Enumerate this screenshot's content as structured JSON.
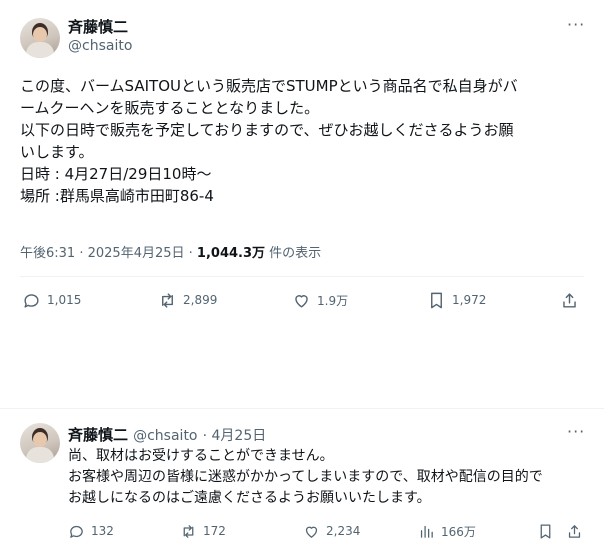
{
  "main_post": {
    "author": {
      "name": "斉藤慎二",
      "handle": "@chsaito"
    },
    "lines": [
      "この度、バームSAITOUという販売店でSTUMPという商品名で私自身がバ",
      "ームクーヘンを販売することとなりました。",
      "以下の日時で販売を予定しておりますので、ぜひお越しくださるようお願",
      "いします。",
      "日時 : 4月27日/29日10時〜",
      "場所 :群馬県高崎市田町86-4"
    ],
    "meta": {
      "time": "午後6:31",
      "date": "2025年4月25日",
      "views": "1,044.3万",
      "views_label": "件の表示"
    },
    "actions": {
      "replies": "1,015",
      "reposts": "2,899",
      "likes": "1.9万",
      "bookmarks": "1,972"
    }
  },
  "reply_post": {
    "author": {
      "name": "斉藤慎二",
      "handle": "@chsaito",
      "date": "4月25日"
    },
    "lines": [
      "尚、取材はお受けすることができません。",
      "お客様や周辺の皆様に迷惑がかかってしまいますので、取材や配信の目的で",
      "お越しになるのはご遠慮くださるようお願いいたします。"
    ],
    "actions": {
      "replies": "132",
      "reposts": "172",
      "likes": "2,234",
      "views": "166万"
    }
  },
  "icons": [
    "more-icon",
    "reply-icon",
    "repost-icon",
    "like-icon",
    "bookmark-icon",
    "share-icon",
    "views-icon"
  ]
}
